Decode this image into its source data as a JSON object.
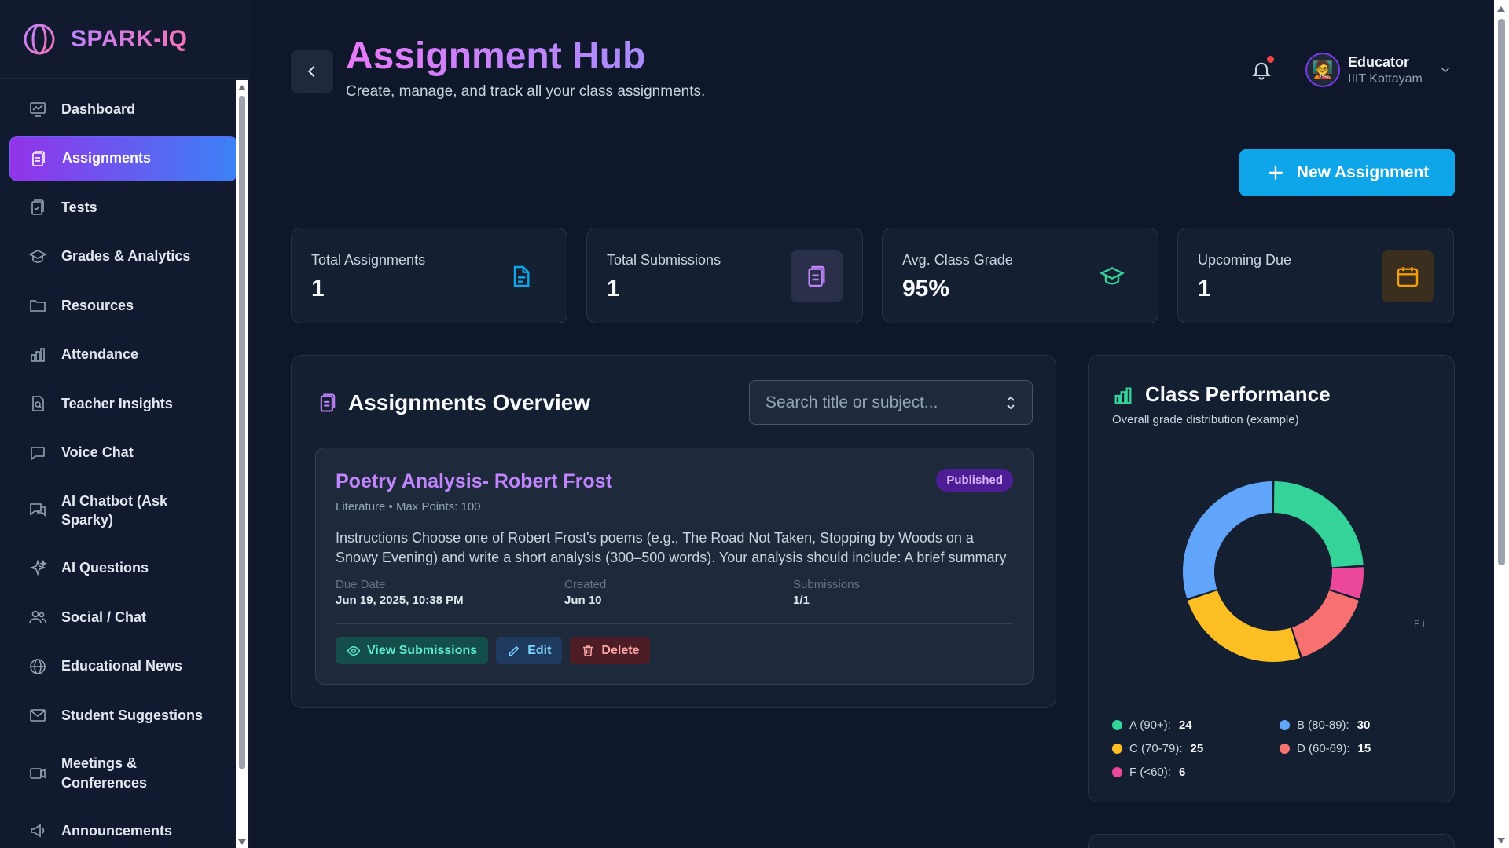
{
  "brand": {
    "name": "SPARK-IQ"
  },
  "sidebar": {
    "items": [
      {
        "label": "Dashboard",
        "icon": "dashboard-icon"
      },
      {
        "label": "Assignments",
        "icon": "assignment-icon",
        "active": true
      },
      {
        "label": "Tests",
        "icon": "test-icon"
      },
      {
        "label": "Grades & Analytics",
        "icon": "graduation-cap-icon"
      },
      {
        "label": "Resources",
        "icon": "folder-icon"
      },
      {
        "label": "Attendance",
        "icon": "bar-chart-icon"
      },
      {
        "label": "Teacher Insights",
        "icon": "document-search-icon"
      },
      {
        "label": "Voice Chat",
        "icon": "chat-icon"
      },
      {
        "label": "AI Chatbot (Ask Sparky)",
        "icon": "chat-bubbles-icon"
      },
      {
        "label": "AI Questions",
        "icon": "sparkles-icon"
      },
      {
        "label": "Social / Chat",
        "icon": "users-icon"
      },
      {
        "label": "Educational News",
        "icon": "globe-icon"
      },
      {
        "label": "Student Suggestions",
        "icon": "mail-icon"
      },
      {
        "label": "Meetings & Conferences",
        "icon": "video-icon"
      },
      {
        "label": "Announcements",
        "icon": "megaphone-icon"
      }
    ]
  },
  "header": {
    "title": "Assignment Hub",
    "subtitle": "Create, manage, and track all your class assignments.",
    "user": {
      "name": "Educator",
      "org": "IIIT Kottayam"
    }
  },
  "actions": {
    "new_assignment": "New Assignment"
  },
  "stats": [
    {
      "label": "Total Assignments",
      "value": "1",
      "icon": "document-icon",
      "color": "#0ea5e9"
    },
    {
      "label": "Total Submissions",
      "value": "1",
      "icon": "clipboard-icon",
      "color": "#c084fc"
    },
    {
      "label": "Avg. Class Grade",
      "value": "95%",
      "icon": "graduation-cap-icon",
      "color": "#34d399"
    },
    {
      "label": "Upcoming Due",
      "value": "1",
      "icon": "calendar-icon",
      "color": "#f59e0b"
    }
  ],
  "overview": {
    "title": "Assignments Overview",
    "search_placeholder": "Search title or subject...",
    "assignments": [
      {
        "title": "Poetry Analysis- Robert Frost",
        "status": "Published",
        "meta": "Literature • Max Points: 100",
        "description": "Instructions Choose one of Robert Frost's poems (e.g., The Road Not Taken, Stopping by Woods on a Snowy Evening) and write a short analysis (300–500 words). Your analysis should include: A brief summary of the poe...",
        "due_label": "Due Date",
        "due_value": "Jun 19, 2025, 10:38 PM",
        "created_label": "Created",
        "created_value": "Jun 10",
        "submissions_label": "Submissions",
        "submissions_value": "1/1",
        "buttons": {
          "view": "View Submissions",
          "edit": "Edit",
          "delete": "Delete"
        }
      }
    ]
  },
  "performance": {
    "title": "Class Performance",
    "subtitle": "Overall grade distribution (example)",
    "stray_label": "F i",
    "legend": [
      {
        "label": "A (90+):",
        "value": 24,
        "color": "#34d399"
      },
      {
        "label": "B (80-89):",
        "value": 30,
        "color": "#60a5fa"
      },
      {
        "label": "C (70-79):",
        "value": 25,
        "color": "#fbbf24"
      },
      {
        "label": "D (60-69):",
        "value": 15,
        "color": "#f87171"
      },
      {
        "label": "F (<60):",
        "value": 6,
        "color": "#ec4899"
      }
    ]
  },
  "chart_data": {
    "type": "pie",
    "categories": [
      "A (90+)",
      "F (<60)",
      "D (60-69)",
      "C (70-79)",
      "B (80-89)"
    ],
    "values": [
      24,
      6,
      15,
      25,
      30
    ],
    "colors": [
      "#34d399",
      "#ec4899",
      "#f87171",
      "#fbbf24",
      "#60a5fa"
    ],
    "title": "Class Performance"
  }
}
